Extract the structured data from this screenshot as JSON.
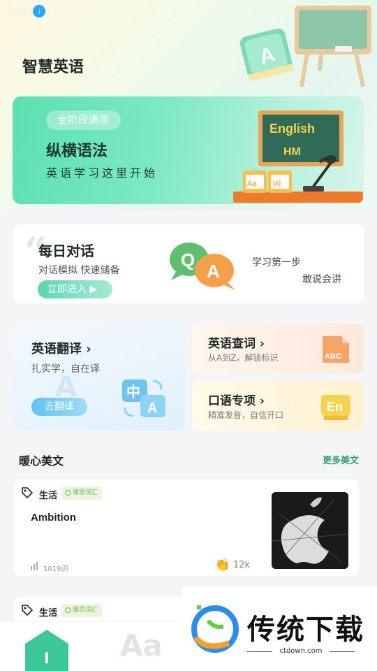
{
  "status": {
    "time": "3:45"
  },
  "header": {
    "title": "智慧英语"
  },
  "banner": {
    "pill": "全阶段通用",
    "title": "纵横语法",
    "subtitle": "英语学习这里开始",
    "board_text_1": "English",
    "board_text_2": "HM",
    "calendar_1": "Aa",
    "calendar_2": "[a]"
  },
  "daily": {
    "title": "每日对话",
    "subtitle": "对话模拟 快速储备",
    "button": "立即进入 ▶",
    "right_line_1": "学习第一步",
    "right_line_2": "敢说会讲"
  },
  "translate": {
    "title": "英语翻译 ›",
    "subtitle": "扎实学，自在译",
    "button": "去翻译",
    "icon_zh": "中",
    "icon_en": "A"
  },
  "lookup": {
    "title": "英语查词 ›",
    "subtitle": "从A到Z，解锁标识",
    "icon_text": "ABC"
  },
  "speaking": {
    "title": "口语专项 ›",
    "subtitle": "精准发音，自信开口",
    "icon_text": "En"
  },
  "articles_section": {
    "title": "暖心美文",
    "more": "更多美文"
  },
  "articles": [
    {
      "tag": "生活",
      "badge": "雅思词汇",
      "heading": "Ambition",
      "words": "1019词",
      "likes": "12k"
    },
    {
      "tag": "生活",
      "badge": "雅思词汇"
    }
  ],
  "tabbar": {
    "word_icon": "Aa"
  },
  "watermark": {
    "brand": "传统下载",
    "url": "ctdown.com"
  },
  "colors": {
    "accent": "#2f9c78",
    "banner": "#5be0b3",
    "translate_button": "#5fc3f2"
  }
}
